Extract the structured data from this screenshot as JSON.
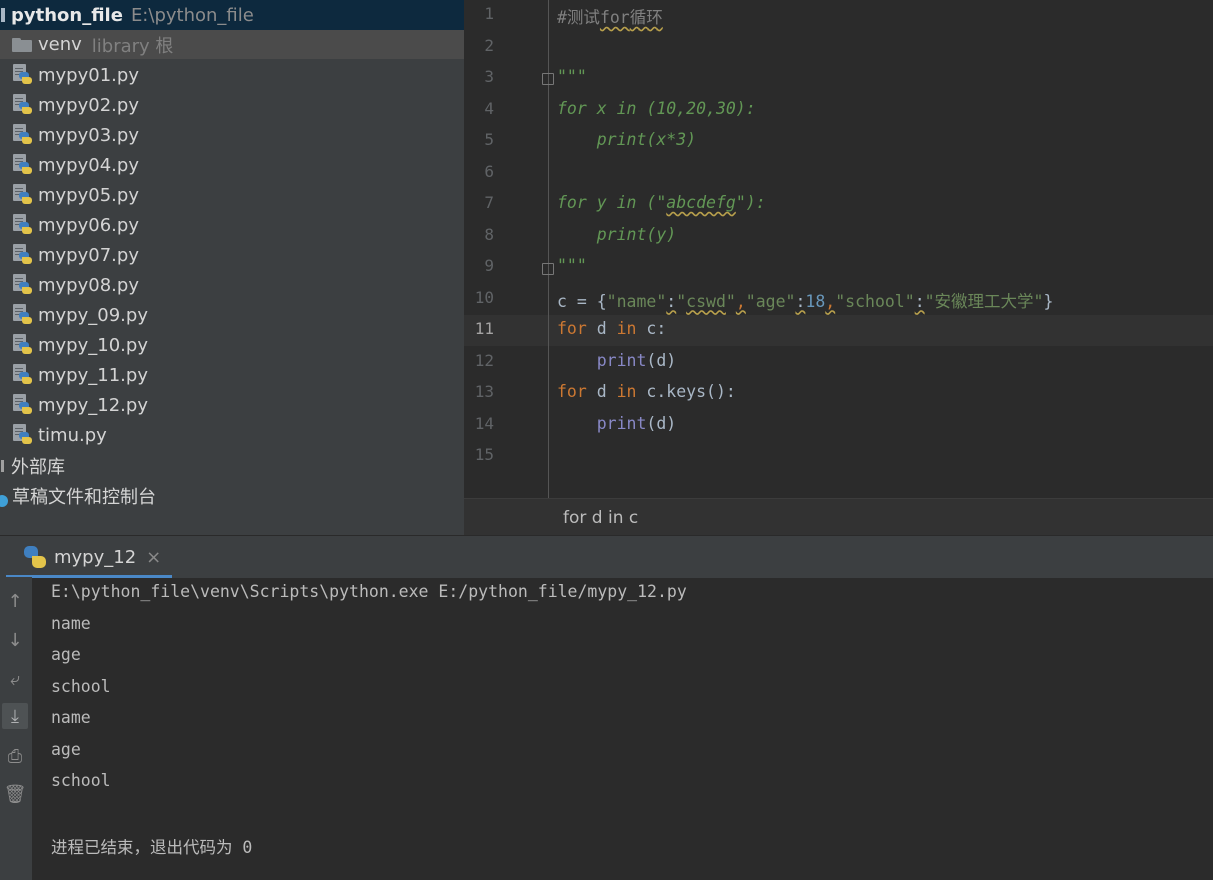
{
  "project": {
    "root_name": "python_file",
    "root_path": "E:\\python_file",
    "venv": {
      "label": "venv",
      "sub": "library 根"
    },
    "files": [
      "mypy01.py",
      "mypy02.py",
      "mypy03.py",
      "mypy04.py",
      "mypy05.py",
      "mypy06.py",
      "mypy07.py",
      "mypy08.py",
      "mypy_09.py",
      "mypy_10.py",
      "mypy_11.py",
      "mypy_12.py",
      "timu.py"
    ],
    "external_libs": "外部库",
    "scratches": "草稿文件和控制台"
  },
  "editor": {
    "current_line": 11,
    "line_numbers": [
      "1",
      "2",
      "3",
      "4",
      "5",
      "6",
      "7",
      "8",
      "9",
      "10",
      "11",
      "12",
      "13",
      "14",
      "15"
    ],
    "lines": [
      [
        {
          "t": "#测试",
          "c": "comment"
        },
        {
          "t": "for",
          "c": "comment squig"
        },
        {
          "t": "循环",
          "c": "comment squig"
        }
      ],
      [],
      [
        {
          "t": "\"\"\"",
          "c": "doc"
        }
      ],
      [
        {
          "t": "for x in (10,20,30):",
          "c": "doc"
        }
      ],
      [
        {
          "t": "    print(x*3)",
          "c": "doc"
        }
      ],
      [],
      [
        {
          "t": "for y in (\"",
          "c": "doc"
        },
        {
          "t": "abcdefg",
          "c": "doc squig"
        },
        {
          "t": "\"):",
          "c": "doc"
        }
      ],
      [
        {
          "t": "    print(y)",
          "c": "doc"
        }
      ],
      [
        {
          "t": "\"\"\"",
          "c": "doc"
        }
      ],
      [
        {
          "t": "c = {",
          "c": ""
        },
        {
          "t": "\"name\"",
          "c": "str"
        },
        {
          "t": ":",
          "c": "squig"
        },
        {
          "t": "\"",
          "c": "str"
        },
        {
          "t": "cswd",
          "c": "str squig"
        },
        {
          "t": "\"",
          "c": "str"
        },
        {
          "t": ",",
          "c": "kw squig"
        },
        {
          "t": "\"age\"",
          "c": "str"
        },
        {
          "t": ":",
          "c": "squig"
        },
        {
          "t": "18",
          "c": "num"
        },
        {
          "t": ",",
          "c": "kw squig"
        },
        {
          "t": "\"school\"",
          "c": "str"
        },
        {
          "t": ":",
          "c": "squig"
        },
        {
          "t": "\"安徽理工大学\"",
          "c": "str"
        },
        {
          "t": "}",
          "c": ""
        }
      ],
      [
        {
          "t": "for",
          "c": "kw"
        },
        {
          "t": " d ",
          "c": ""
        },
        {
          "t": "in",
          "c": "kw"
        },
        {
          "t": " c:",
          "c": ""
        }
      ],
      [
        {
          "t": "    ",
          "c": ""
        },
        {
          "t": "print",
          "c": "builtin"
        },
        {
          "t": "(d)",
          "c": ""
        }
      ],
      [
        {
          "t": "for",
          "c": "kw"
        },
        {
          "t": " d ",
          "c": ""
        },
        {
          "t": "in",
          "c": "kw"
        },
        {
          "t": " c.keys():",
          "c": ""
        }
      ],
      [
        {
          "t": "    ",
          "c": ""
        },
        {
          "t": "print",
          "c": "builtin"
        },
        {
          "t": "(d)",
          "c": ""
        }
      ],
      []
    ],
    "breadcrumb": "for d in c"
  },
  "run": {
    "tab_label": "mypy_12",
    "tab_close": "×",
    "toolbar_icons": [
      "arrow-up-icon",
      "arrow-down-icon",
      "soft-wrap-icon",
      "scroll-to-end-icon",
      "print-icon",
      "trash-icon"
    ],
    "output": [
      "E:\\python_file\\venv\\Scripts\\python.exe E:/python_file/mypy_12.py",
      "name",
      "age",
      "school",
      "name",
      "age",
      "school",
      "",
      "进程已结束，退出代码为 0"
    ]
  },
  "colors": {
    "keyword": "#cc7832",
    "string": "#6a8759",
    "number": "#6897bb",
    "docstring": "#629755",
    "comment": "#808080",
    "builtin": "#8888c6",
    "selection": "#0d293e"
  }
}
